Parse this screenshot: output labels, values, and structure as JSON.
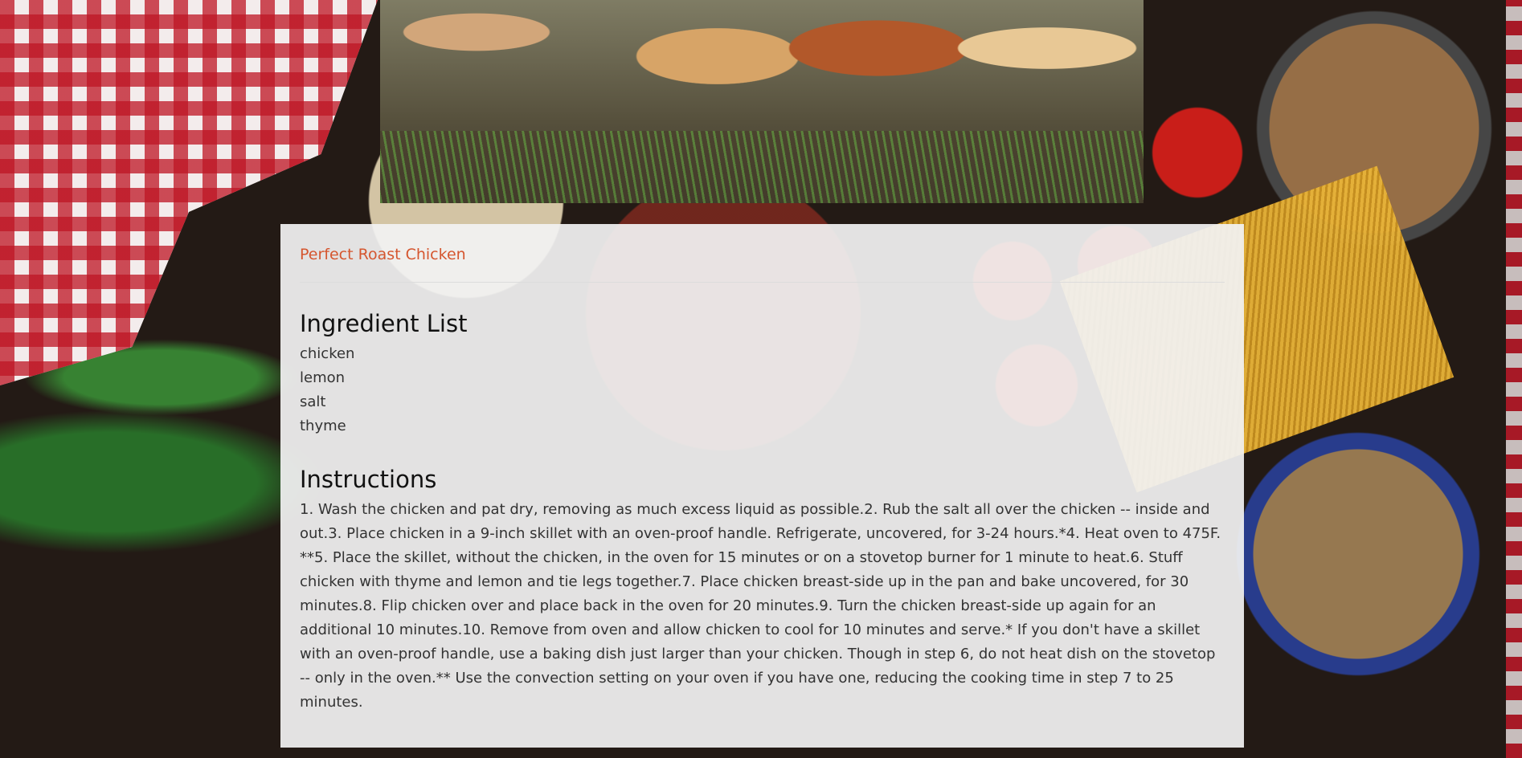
{
  "recipe": {
    "title": "Perfect Roast Chicken"
  },
  "ingredients": {
    "heading": "Ingredient List",
    "items": [
      "chicken",
      "lemon",
      "salt",
      "thyme"
    ]
  },
  "instructions": {
    "heading": "Instructions",
    "text": "1. Wash the chicken and pat dry, removing as much excess liquid as possible.2. Rub the salt all over the chicken -- inside and out.3. Place chicken in a 9-inch skillet with an oven-proof handle. Refrigerate, uncovered, for 3-24 hours.*4. Heat oven to 475F. **5. Place the skillet, without the chicken, in the oven for 15 minutes or on a stovetop burner for 1 minute to heat.6. Stuff chicken with thyme and lemon and tie legs together.7. Place chicken breast-side up in the pan and bake uncovered, for 30 minutes.8. Flip chicken over and place back in the oven for 20 minutes.9. Turn the chicken breast-side up again for an additional 10 minutes.10. Remove from oven and allow chicken to cool for 10 minutes and serve.* If you don't have a skillet with an oven-proof handle, use a baking dish just larger than your chicken. Though in step 6, do not heat dish on the stovetop -- only in the oven.** Use the convection setting on your oven if you have one, reducing the cooking time in step 7 to 25 minutes."
  },
  "images": {
    "hero": "chickens-photo",
    "background": "food-ingredients-photo"
  },
  "colors": {
    "title": "#d5562f",
    "panel_background": "#f2f2f2"
  }
}
